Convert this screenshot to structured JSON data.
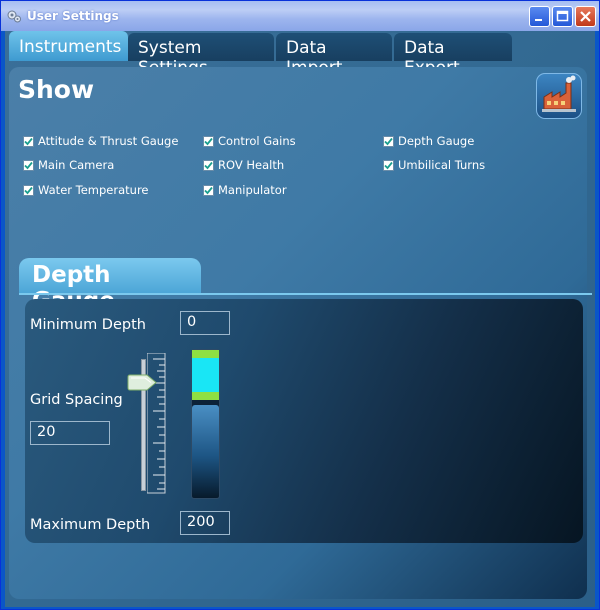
{
  "window": {
    "title": "User Settings",
    "icon": "gears-icon",
    "controls": [
      "minimize-icon",
      "maximize-icon",
      "close-icon"
    ]
  },
  "tabs": [
    {
      "label": "Instruments",
      "active": true
    },
    {
      "label": "System Settings",
      "active": false
    },
    {
      "label": "Data Import",
      "active": false
    },
    {
      "label": "Data Export",
      "active": false
    }
  ],
  "show": {
    "title": "Show",
    "action_icon": "factory-icon",
    "checkboxes": [
      {
        "label": "Attitude & Thrust Gauge",
        "checked": true
      },
      {
        "label": "Control Gains",
        "checked": true
      },
      {
        "label": "Depth Gauge",
        "checked": true
      },
      {
        "label": "Main Camera",
        "checked": true
      },
      {
        "label": "ROV Health",
        "checked": true
      },
      {
        "label": "Umbilical Turns",
        "checked": true
      },
      {
        "label": "Water Temperature",
        "checked": true
      },
      {
        "label": "Manipulator",
        "checked": true
      }
    ]
  },
  "depth_gauge": {
    "title": "Depth Gauge",
    "min_label": "Minimum Depth",
    "min_value": "0",
    "grid_label": "Grid Spacing",
    "grid_value": "20",
    "max_label": "Maximum Depth",
    "max_value": "200",
    "slider_level": 0.82
  },
  "colors": {
    "accent": "#4ba5d6",
    "indicator_cyan": "#19e6f5",
    "indicator_green": "#8fe043"
  }
}
